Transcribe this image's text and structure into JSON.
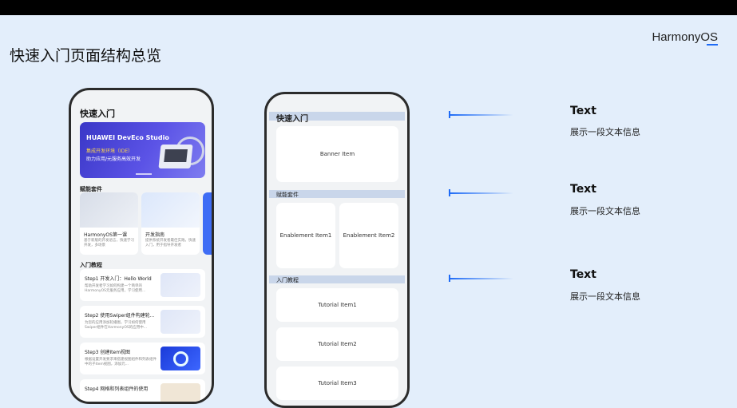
{
  "page": {
    "title": "快速入门页面结构总览",
    "brand": "HarmonyOS"
  },
  "left_phone": {
    "header": "快速入门",
    "banner": {
      "title": "HUAWEI DevEco Studio",
      "line1": "集成开发环境（IDE）",
      "line2": "助力应用/元服务高效开发"
    },
    "section_enablement": "赋能套件",
    "enablement": [
      {
        "title": "HarmonyOS第一课",
        "desc": "基于新版的开发语言，快速学习开发，多场景"
      },
      {
        "title": "开发指南",
        "desc": "提供系统开发者最佳实践，快速入门，用于指导开发者"
      }
    ],
    "section_tutorial": "入门教程",
    "tutorials": [
      {
        "title": "Step1 开发入门：Hello World",
        "desc": "帮助开发者学习如何构建一个简单的HarmonyOS元服务应用，学习使用..."
      },
      {
        "title": "Step2 使用Swiper组件构建轮...",
        "desc": "为您的应用添加轮播图，学习如何使用Swiper组件在HarmonyOS的应用中..."
      },
      {
        "title": "Step3 创建Item视图",
        "desc": "根据设置开发要求来搭建视图组件和列表组件中的子Item视图，添加元..."
      },
      {
        "title": "Step4 网格和列表组件的使用",
        "desc": ""
      }
    ]
  },
  "right_phone": {
    "header": "快速入门",
    "banner": "Banner Item",
    "section_enablement": "赋能套件",
    "enablement": [
      "Enablement Item1",
      "Enablement Item2"
    ],
    "section_tutorial": "入门教程",
    "tutorials": [
      "Tutorial Item1",
      "Tutorial Item2",
      "Tutorial Item3"
    ]
  },
  "annotations": [
    {
      "title": "Text",
      "desc": "展示一段文本信息"
    },
    {
      "title": "Text",
      "desc": "展示一段文本信息"
    },
    {
      "title": "Text",
      "desc": "展示一段文本信息"
    }
  ],
  "colors": {
    "accent": "#1e6bf6",
    "background": "#e3eefb",
    "banner": "#4a44d9"
  }
}
